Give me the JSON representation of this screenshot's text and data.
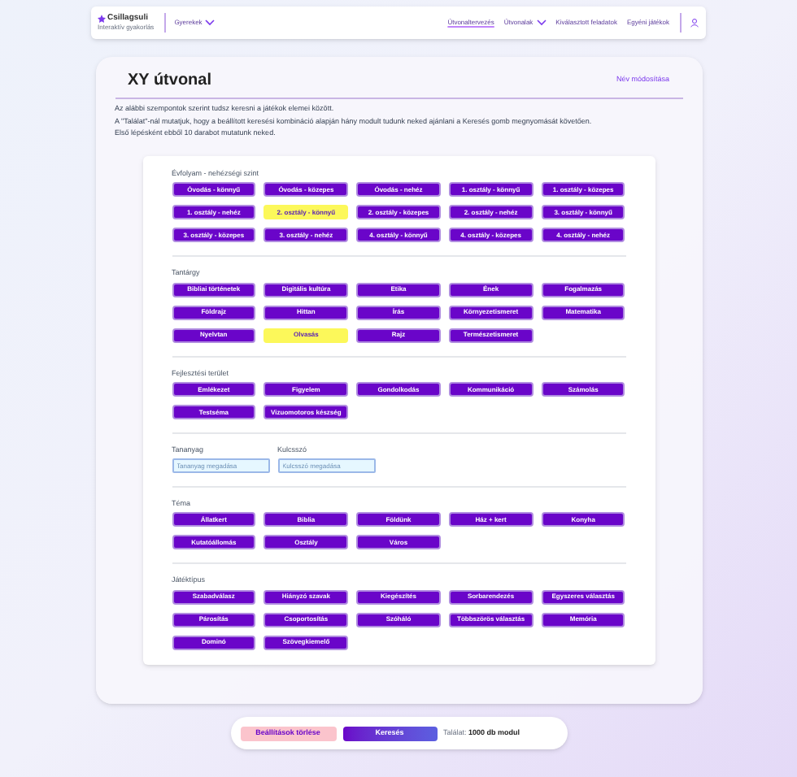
{
  "header": {
    "logo": "Csillagsuli",
    "logo_subtitle": "Interaktív gyakorlás",
    "nav_left": {
      "label": "Gyerekek"
    },
    "nav": [
      {
        "label": "Útvonaltervezés",
        "selected": true,
        "dropdown": false
      },
      {
        "label": "Útvonalak",
        "selected": false,
        "dropdown": true
      },
      {
        "label": "Kiválasztott feladatok",
        "selected": false,
        "dropdown": false
      },
      {
        "label": "Egyéni játékok",
        "selected": false,
        "dropdown": false
      }
    ]
  },
  "title": "XY útvonal",
  "rename_link": "Név módosítása",
  "description": [
    "Az alábbi szempontok szerint tudsz keresni a játékok elemei között.",
    "A \"Találat\"-nál mutatjuk, hogy a beállított keresési kombináció alapján hány modult tudunk neked ajánlani a Keresés gomb megnyomását követően.",
    "Első lépésként ebből 10 darabot mutatunk neked."
  ],
  "sections": [
    {
      "kind": "chips",
      "label": "Évfolyam - nehézségi szint",
      "chips": [
        {
          "label": "Óvodás - könnyű",
          "selected": false
        },
        {
          "label": "Óvodás - közepes",
          "selected": false
        },
        {
          "label": "Óvodás - nehéz",
          "selected": false
        },
        {
          "label": "1. osztály - könnyű",
          "selected": false
        },
        {
          "label": "1. osztály - közepes",
          "selected": false
        },
        {
          "label": "1. osztály - nehéz",
          "selected": false
        },
        {
          "label": "2. osztály - könnyű",
          "selected": true
        },
        {
          "label": "2. osztály - közepes",
          "selected": false
        },
        {
          "label": "2. osztály - nehéz",
          "selected": false
        },
        {
          "label": "3. osztály - könnyű",
          "selected": false
        },
        {
          "label": "3. osztály - közepes",
          "selected": false
        },
        {
          "label": "3. osztály - nehéz",
          "selected": false
        },
        {
          "label": "4. osztály - könnyű",
          "selected": false
        },
        {
          "label": "4. osztály - közepes",
          "selected": false
        },
        {
          "label": "4. osztály - nehéz",
          "selected": false
        }
      ]
    },
    {
      "kind": "chips",
      "label": "Tantárgy",
      "chips": [
        {
          "label": "Bibliai történetek",
          "selected": false
        },
        {
          "label": "Digitális kultúra",
          "selected": false
        },
        {
          "label": "Etika",
          "selected": false
        },
        {
          "label": "Ének",
          "selected": false
        },
        {
          "label": "Fogalmazás",
          "selected": false
        },
        {
          "label": "Földrajz",
          "selected": false
        },
        {
          "label": "Hittan",
          "selected": false
        },
        {
          "label": "Írás",
          "selected": false
        },
        {
          "label": "Környezetismeret",
          "selected": false
        },
        {
          "label": "Matematika",
          "selected": false
        },
        {
          "label": "Nyelvtan",
          "selected": false
        },
        {
          "label": "Olvasás",
          "selected": true
        },
        {
          "label": "Rajz",
          "selected": false
        },
        {
          "label": "Természetismeret",
          "selected": false
        }
      ]
    },
    {
      "kind": "chips",
      "label": "Fejlesztési terület",
      "chips": [
        {
          "label": "Emlékezet",
          "selected": false
        },
        {
          "label": "Figyelem",
          "selected": false
        },
        {
          "label": "Gondolkodás",
          "selected": false
        },
        {
          "label": "Kommunikáció",
          "selected": false
        },
        {
          "label": "Számolás",
          "selected": false
        },
        {
          "label": "Testséma",
          "selected": false
        },
        {
          "label": "Vizuomotoros készség",
          "selected": false
        }
      ]
    },
    {
      "kind": "fields",
      "fields": [
        {
          "label": "Tananyag",
          "placeholder": "Tananyag megadása"
        },
        {
          "label": "Kulcsszó",
          "placeholder": "Kulcsszó megadása"
        }
      ]
    },
    {
      "kind": "chips",
      "label": "Téma",
      "chips": [
        {
          "label": "Állatkert",
          "selected": false
        },
        {
          "label": "Biblia",
          "selected": false
        },
        {
          "label": "Földünk",
          "selected": false
        },
        {
          "label": "Ház + kert",
          "selected": false
        },
        {
          "label": "Konyha",
          "selected": false
        },
        {
          "label": "Kutatóállomás",
          "selected": false
        },
        {
          "label": "Osztály",
          "selected": false
        },
        {
          "label": "Város",
          "selected": false
        }
      ]
    },
    {
      "kind": "chips",
      "label": "Játéktípus",
      "chips": [
        {
          "label": "Szabadválasz",
          "selected": false
        },
        {
          "label": "Hiányzó szavak",
          "selected": false
        },
        {
          "label": "Kiegészítés",
          "selected": false
        },
        {
          "label": "Sorbarendezés",
          "selected": false
        },
        {
          "label": "Egyszeres választás",
          "selected": false
        },
        {
          "label": "Párosítás",
          "selected": false
        },
        {
          "label": "Csoportosítás",
          "selected": false
        },
        {
          "label": "Szóháló",
          "selected": false
        },
        {
          "label": "Többszörös választás",
          "selected": false
        },
        {
          "label": "Memória",
          "selected": false
        },
        {
          "label": "Dominó",
          "selected": false
        },
        {
          "label": "Szövegkiemelő",
          "selected": false
        }
      ]
    }
  ],
  "footer": {
    "reset_button": "Beállítások törlése",
    "search_button": "Keresés",
    "result_label": "Találat:",
    "result_value": "1000 db modul"
  }
}
